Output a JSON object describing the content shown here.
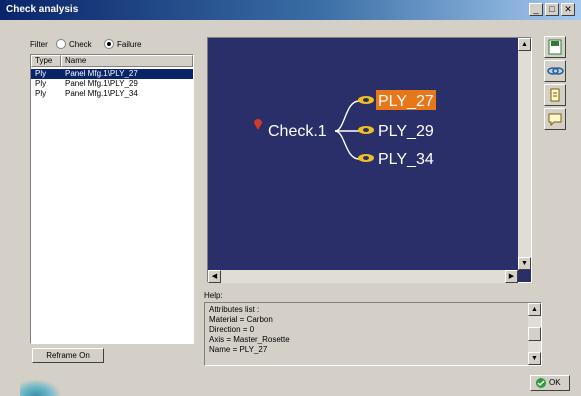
{
  "window": {
    "title": "Check analysis",
    "buttons": [
      "_",
      "□",
      "✕"
    ]
  },
  "filter": {
    "label": "Filter",
    "options": [
      {
        "label": "Check",
        "selected": false
      },
      {
        "label": "Failure",
        "selected": true
      }
    ]
  },
  "list": {
    "columns": [
      "Type",
      "Name"
    ],
    "rows": [
      {
        "type": "Ply",
        "name": "Panel Mfg.1\\PLY_27",
        "selected": true
      },
      {
        "type": "Ply",
        "name": "Panel Mfg.1\\PLY_29",
        "selected": false
      },
      {
        "type": "Ply",
        "name": "Panel Mfg.1\\PLY_34",
        "selected": false
      }
    ]
  },
  "reframe_button": "Reframe On",
  "graph": {
    "root": "Check.1",
    "children": [
      {
        "label": "PLY_27",
        "highlighted": true
      },
      {
        "label": "PLY_29",
        "highlighted": false
      },
      {
        "label": "PLY_34",
        "highlighted": false
      }
    ],
    "background_color": "#2a2f6a",
    "highlight_color": "#e8771a"
  },
  "toolbar_icons": [
    "save-icon",
    "link-icon",
    "edit-icon",
    "comment-icon"
  ],
  "help": {
    "label": "Help:",
    "lines": [
      "Attributes list :",
      "Material = Carbon",
      "Direction = 0",
      "Axis = Master_Rosette",
      "Name = PLY_27"
    ]
  },
  "ok_button": "OK"
}
